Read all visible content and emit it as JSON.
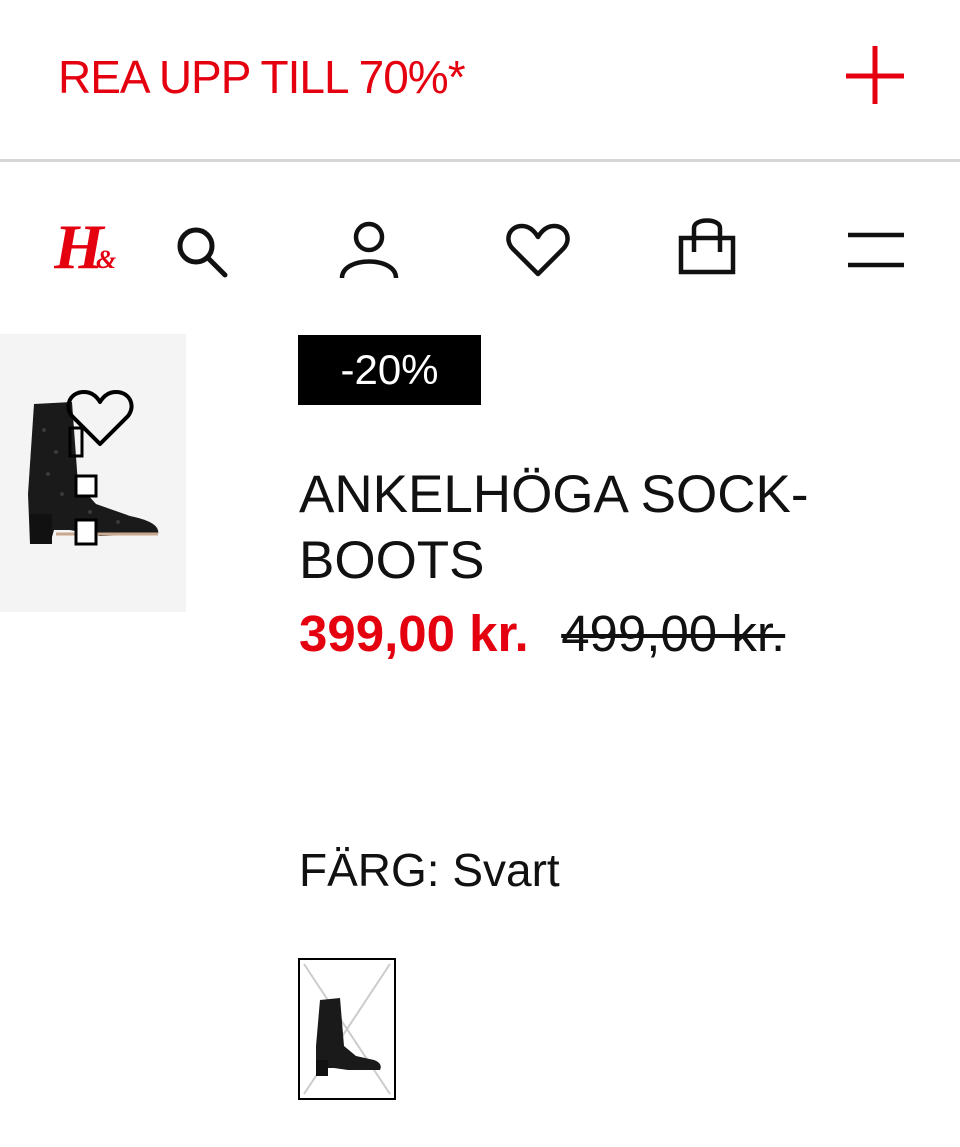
{
  "promo": {
    "text": "REA UPP TILL 70%*",
    "toggle_icon": "plus-icon"
  },
  "header": {
    "logo_text": "H&",
    "icons": [
      "search-icon",
      "account-icon",
      "favorites-heart-icon",
      "shopping-bag-icon",
      "menu-icon"
    ]
  },
  "product": {
    "discount_badge": "-20%",
    "title": "ANKELHÖGA SOCK-BOOTS",
    "price_sale": "399,00 kr.",
    "price_original": "499,00 kr.",
    "color_label": "FÄRG: Svart",
    "favorite_icon": "heart-outline-icon"
  },
  "colors": {
    "brand_red": "#e50010",
    "text": "#111111",
    "badge_bg": "#000000"
  }
}
